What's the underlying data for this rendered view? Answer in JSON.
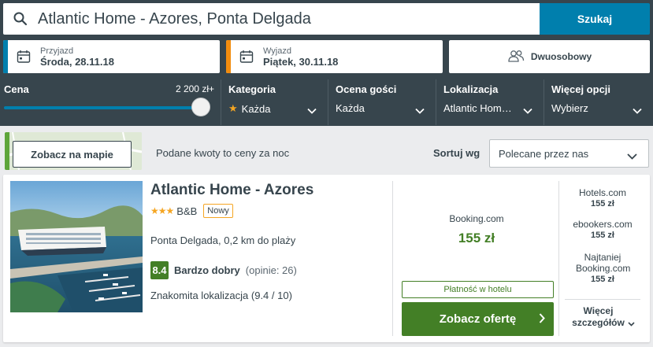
{
  "search": {
    "query": "Atlantic Home - Azores, Ponta Delgada",
    "button_label": "Szukaj",
    "accent_color": "#007fad"
  },
  "dates": {
    "checkin": {
      "label": "Przyjazd",
      "value": "Środa, 28.11.18",
      "color": "#007fad"
    },
    "checkout": {
      "label": "Wyjazd",
      "value": "Piątek, 30.11.18",
      "color": "#f28c0f"
    }
  },
  "room": {
    "label": "Dwuosobowy",
    "icon": "people-icon"
  },
  "filters": {
    "price": {
      "title": "Cena",
      "max": "2 200 zł+",
      "level_percent": 100
    },
    "category": {
      "title": "Kategoria",
      "value": "Każda",
      "icon": "star-icon"
    },
    "rating": {
      "title": "Ocena gości",
      "value": "Każda"
    },
    "location": {
      "title": "Lokalizacja",
      "value": "Atlantic Hom…"
    },
    "more": {
      "title": "Więcej opcji",
      "value": "Wybierz"
    }
  },
  "toolbar": {
    "map_button": "Zobacz na mapie",
    "price_note": "Podane kwoty to ceny za noc",
    "sort_label": "Sortuj wg",
    "sort_value": "Polecane przez nas"
  },
  "result": {
    "name": "Atlantic Home - Azores",
    "stars": 3,
    "stars_text": "★★★",
    "type": "B&B",
    "badge": "Nowy",
    "location": "Ponta Delgada, 0,2 km do plaży",
    "score": "8.4",
    "score_label": "Bardzo dobry",
    "reviews": "(opinie: 26)",
    "location_score": "Znakomita lokalizacja (9.4 / 10)",
    "offer": {
      "site": "Booking.com",
      "price": "155 zł",
      "pay_note": "Płatność w hotelu",
      "cta": "Zobacz ofertę"
    },
    "alternatives": [
      {
        "site": "Hotels.com",
        "price": "155 zł"
      },
      {
        "site": "ebookers.com",
        "price": "155 zł"
      },
      {
        "site": "Najtaniej Booking.com",
        "price": "155 zł"
      }
    ],
    "more_label": "Więcej szczegółów"
  }
}
